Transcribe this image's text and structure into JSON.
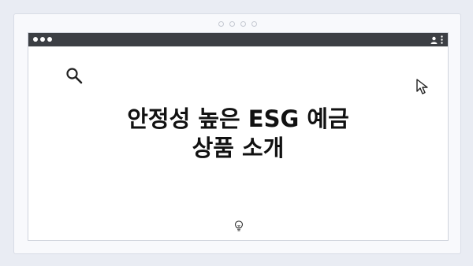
{
  "window": {
    "title_lines": [
      "안정성 높은 ESG 예금",
      "상품 소개"
    ]
  },
  "icons": {
    "pager_dots": [
      "pager-dot",
      "pager-dot",
      "pager-dot",
      "pager-dot"
    ],
    "window_controls": [
      "window-dot",
      "window-dot",
      "window-dot"
    ],
    "toolbar_right": [
      "user-icon",
      "kebab-menu-icon"
    ],
    "content": [
      "search-icon",
      "cursor-icon",
      "lightbulb-icon"
    ]
  },
  "colors": {
    "background": "#e9ecf3",
    "titlebar": "#3c3f44",
    "text": "#111111"
  }
}
